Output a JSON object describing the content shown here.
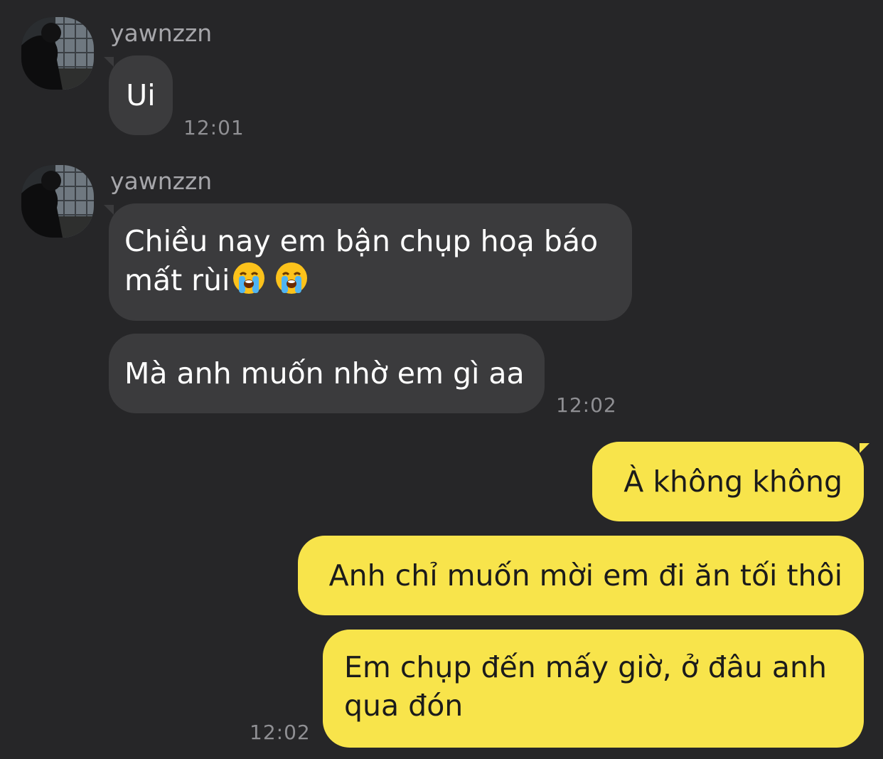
{
  "chat": {
    "messages": [
      {
        "sender": "yawnzzn",
        "bubbles": [
          "Ui"
        ],
        "time": "12:01"
      },
      {
        "sender": "yawnzzn",
        "bubbles": [
          "Chiều nay em bận chụp hoạ báo mất rùi",
          "Mà anh muốn nhờ em gì aa"
        ],
        "emoji": [
          "loudly-crying-face",
          "loudly-crying-face"
        ],
        "time": "12:02"
      },
      {
        "sender": "me",
        "bubbles": [
          "À không không",
          "Anh chỉ muốn mời em đi ăn tối thôi",
          "Em chụp đến mấy giờ, ở đâu anh qua đón"
        ],
        "time": "12:02"
      }
    ]
  },
  "colors": {
    "background": "#262628",
    "incoming_bubble": "#3b3b3d",
    "outgoing_bubble": "#f8e44b",
    "sender_name": "#a6a6aa",
    "timestamp": "#8f8f93"
  }
}
